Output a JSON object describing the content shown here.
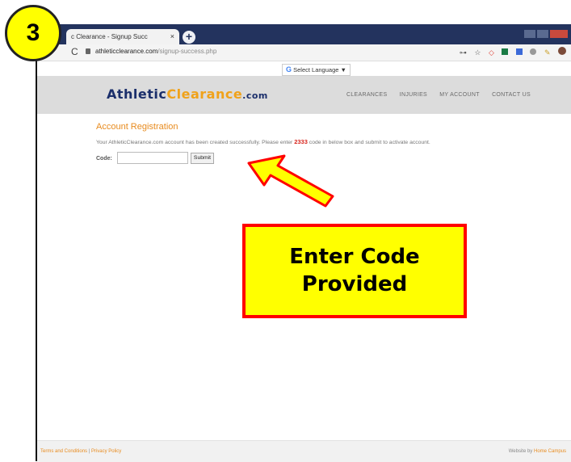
{
  "step_badge": "3",
  "browser": {
    "tab_title": "c Clearance - Signup Succ",
    "tab_close": "×",
    "new_tab": "+",
    "reload_icon": "C",
    "url_host": "athleticclearance.com",
    "url_path": "/signup-success.php"
  },
  "translate": {
    "g_icon": "G",
    "label": "Select Language",
    "caret": "▼"
  },
  "header": {
    "logo_part1": "Athletic",
    "logo_part2": "Clearance",
    "logo_part3": ".com",
    "nav": [
      "CLEARANCES",
      "INJURIES",
      "MY ACCOUNT",
      "CONTACT US"
    ]
  },
  "content": {
    "title": "Account Registration",
    "message_before": "Your AthleticClearance.com account has been created successfully. Please enter ",
    "code_value": "2333",
    "message_after": " code in below box and submit to activate account.",
    "code_label": "Code:",
    "code_input_value": "",
    "submit_label": "Submit"
  },
  "footer": {
    "terms": "Terms and Conditions",
    "separator": " | ",
    "privacy": "Privacy Policy",
    "website_by": "Website by ",
    "agency": "Home Campus"
  },
  "callout": {
    "line1": "Enter Code",
    "line2": "Provided"
  },
  "colors": {
    "accent_orange": "#e88b1e",
    "code_red": "#d7261e",
    "callout_fill": "#ffff00",
    "callout_border": "#ff0000",
    "tab_strip": "#23335e"
  }
}
